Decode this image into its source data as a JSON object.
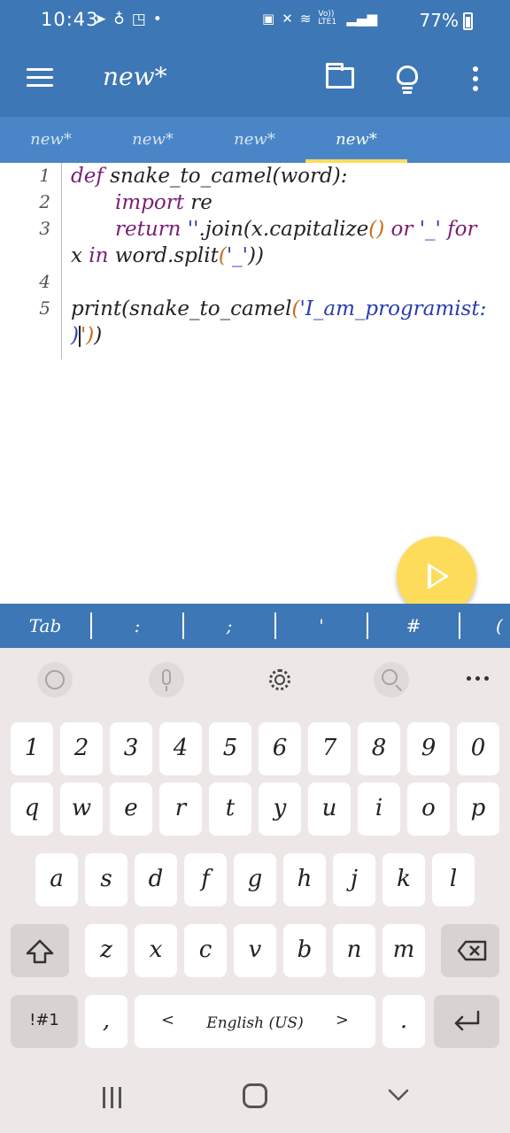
{
  "status_bar": {
    "time": "10:43",
    "left_icons": [
      "telegram-icon",
      "app-icon",
      "notification-icon",
      "dot"
    ],
    "network_label": "Vo)) LTE1",
    "battery": "77%"
  },
  "toolbar": {
    "title": "new*"
  },
  "tabs": [
    {
      "label": "new*"
    },
    {
      "label": "new*"
    },
    {
      "label": "new*"
    },
    {
      "label": "new*",
      "active": true
    }
  ],
  "editor": {
    "line_numbers": [
      "1",
      "2",
      "3",
      "4",
      "5"
    ],
    "code": {
      "l1_kw": "def",
      "l1_name": " snake_to_camel",
      "l1_open": "(",
      "l1_arg": "word",
      "l1_close": "):",
      "l2_kw": "import",
      "l2_rest": " re",
      "l3_kw": "return",
      "l3_str": " ''",
      "l3_join": ".join",
      "l3_p1": "(",
      "l3_x": "x.capitalize",
      "l3_pp": "()",
      "l3_or": " or ",
      "l3_us": "'_'",
      "l3_for": " for",
      "l3b_x": "x ",
      "l3b_in": "in",
      "l3b_rest": " word.split",
      "l3b_p": "(",
      "l3b_us": "'_'",
      "l3b_close": "))",
      "l5_fn": "print",
      "l5_p": "(",
      "l5_name": "snake_to_camel",
      "l5_p2": "(",
      "l5_str": "'I_am_programist:",
      "l5b_a": ")",
      "l5b_b": "')",
      "l5b_c": ")"
    }
  },
  "shortcuts": [
    "Tab",
    ":",
    ";",
    "'",
    "#",
    "("
  ],
  "keyboard": {
    "row_numbers": [
      "1",
      "2",
      "3",
      "4",
      "5",
      "6",
      "7",
      "8",
      "9",
      "0"
    ],
    "row_1": [
      "q",
      "w",
      "e",
      "r",
      "t",
      "y",
      "u",
      "i",
      "o",
      "p"
    ],
    "row_2": [
      "a",
      "s",
      "d",
      "f",
      "g",
      "h",
      "j",
      "k",
      "l"
    ],
    "row_3": [
      "z",
      "x",
      "c",
      "v",
      "b",
      "n",
      "m"
    ],
    "symbols_label": "!#1",
    "comma": ",",
    "space_left": "<",
    "space_label": "English (US)",
    "space_right": ">",
    "period": "."
  },
  "colors": {
    "toolbar": "#3d77b5",
    "tab_bar": "#4a86c7",
    "accent": "#fddc5c",
    "keyword": "#7a1e74",
    "string": "#2a3cb0",
    "paren": "#c86b1b"
  }
}
